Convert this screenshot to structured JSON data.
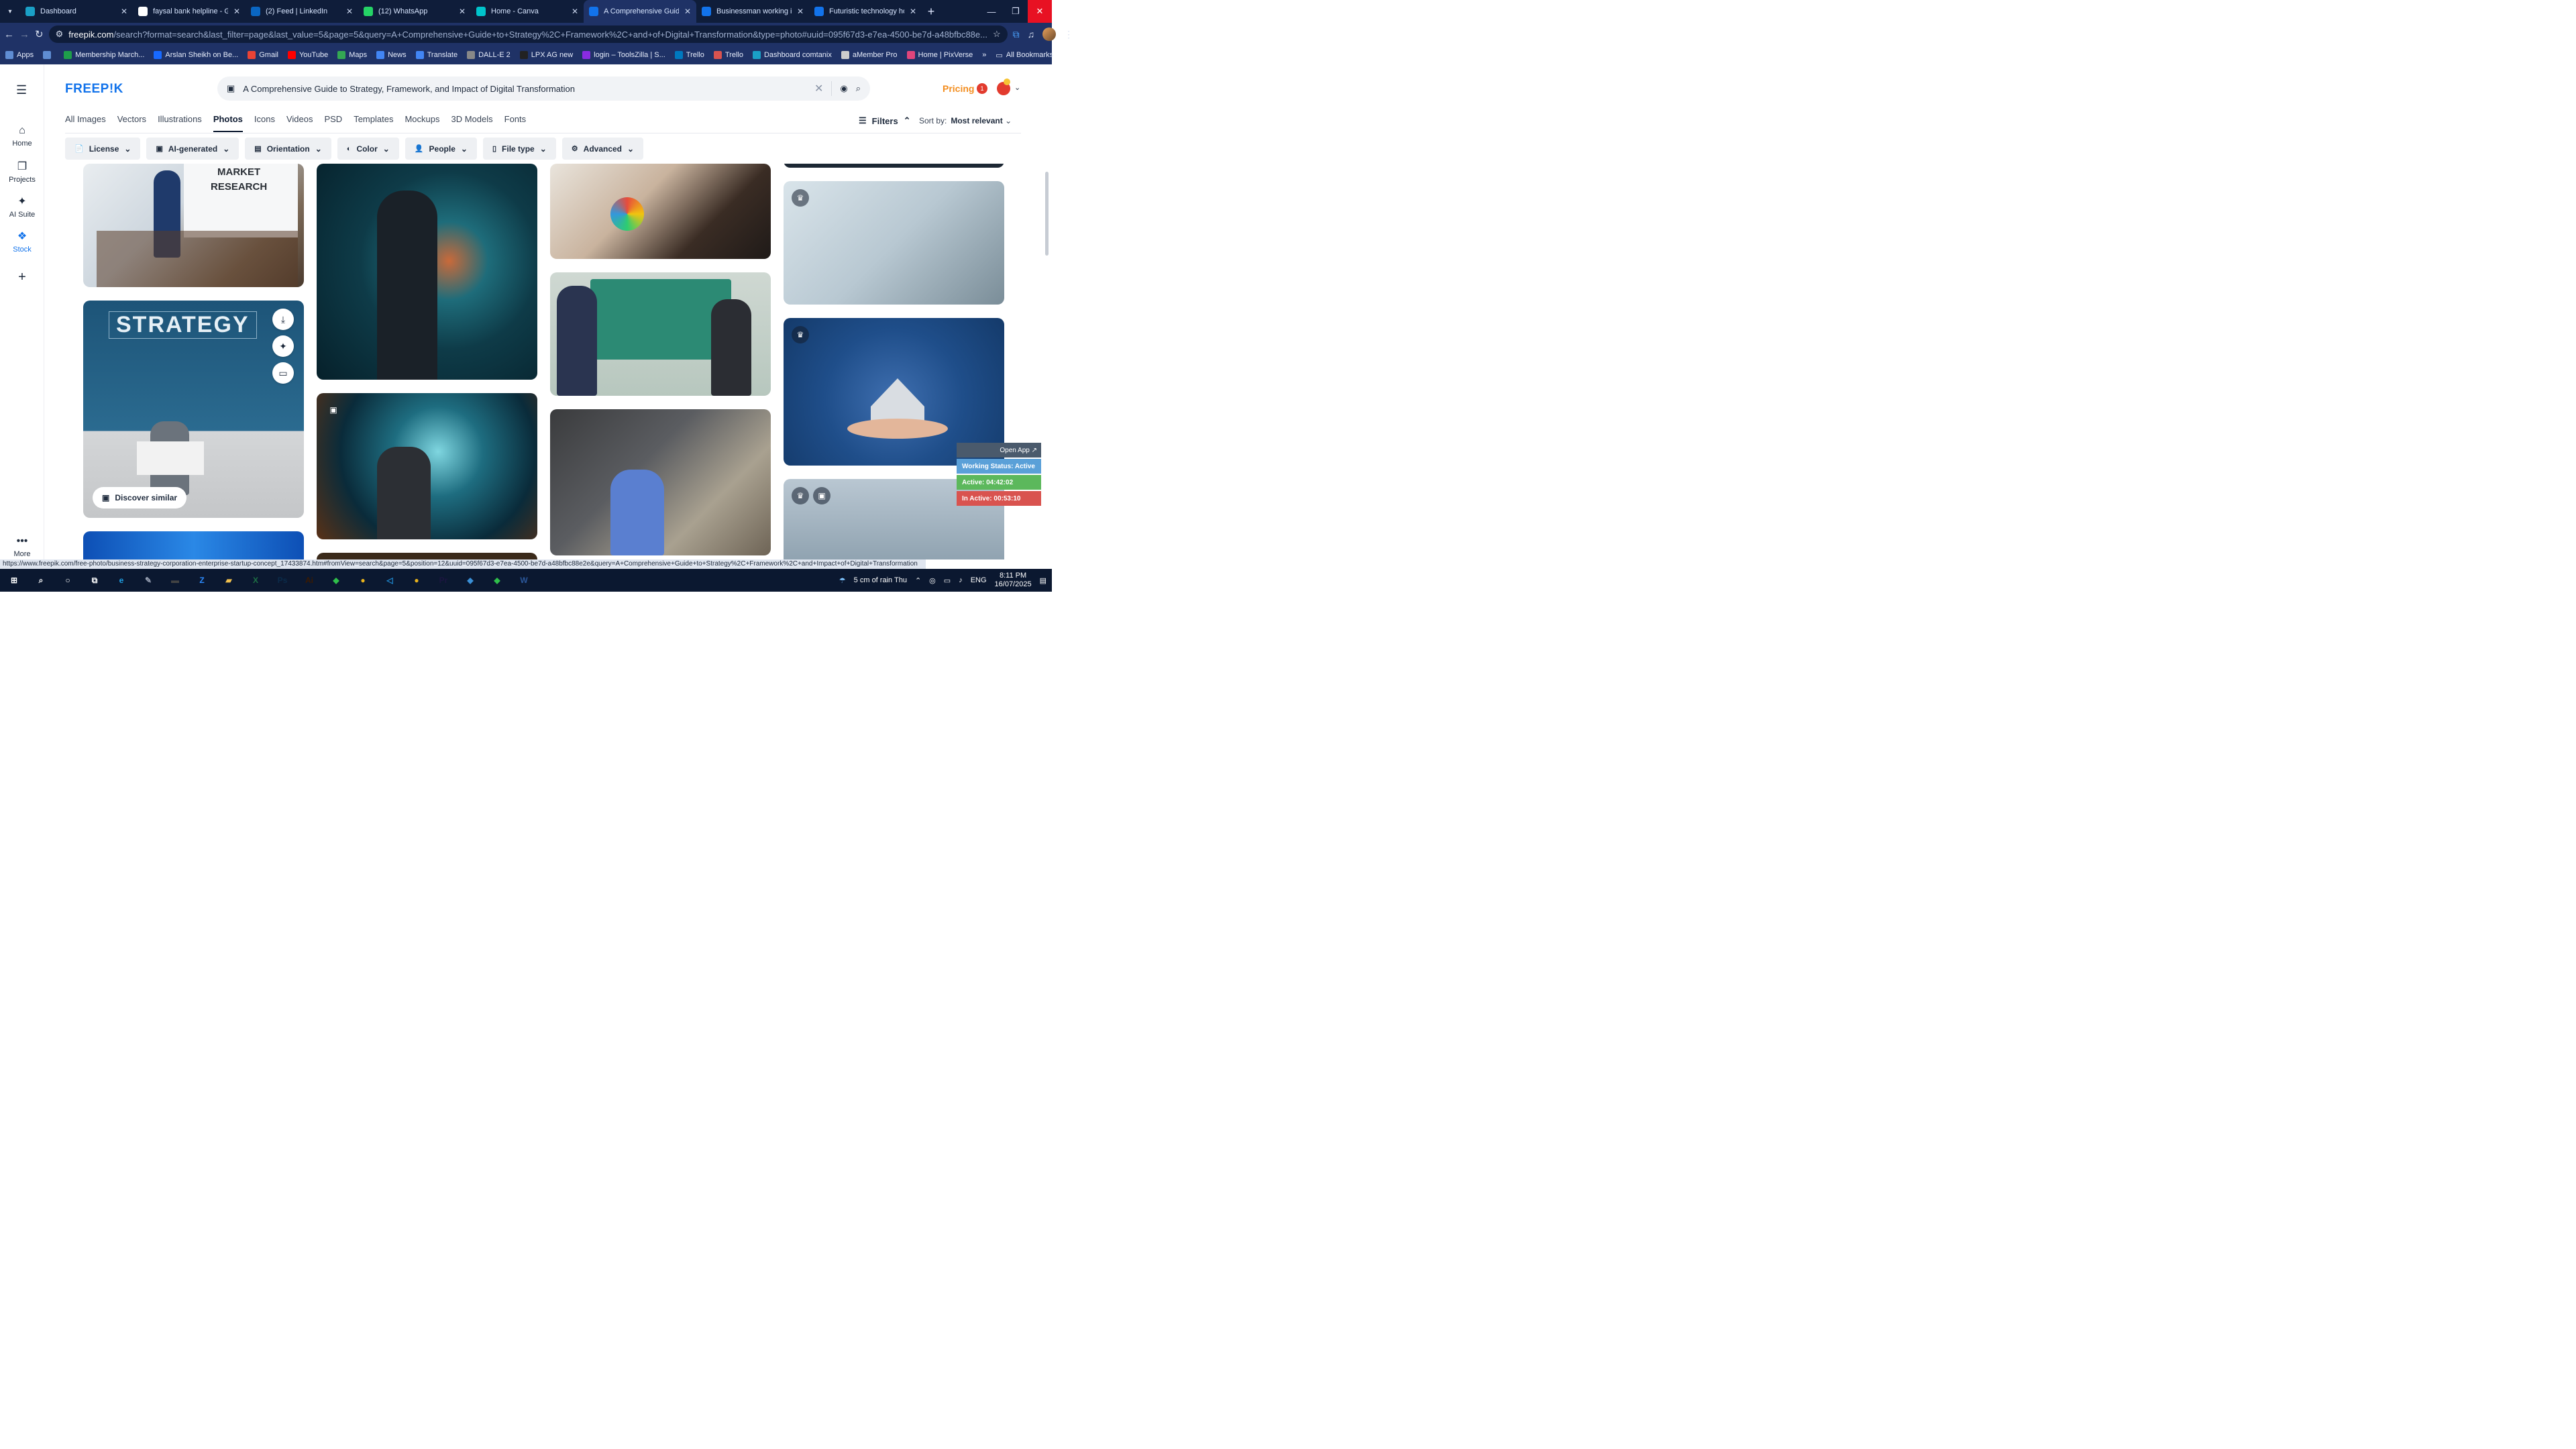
{
  "tabs": [
    {
      "title": "Dashboard",
      "color": "#1aa0c7"
    },
    {
      "title": "faysal bank helpline - Go",
      "color": "#ffffff"
    },
    {
      "title": "(2) Feed | LinkedIn",
      "color": "#0a66c2"
    },
    {
      "title": "(12) WhatsApp",
      "color": "#25d366"
    },
    {
      "title": "Home - Canva",
      "color": "#00c4cc"
    },
    {
      "title": "A Comprehensive Guide t",
      "color": "#1273eb"
    },
    {
      "title": "Businessman working in c",
      "color": "#1273eb"
    },
    {
      "title": "Futuristic technology holo",
      "color": "#1273eb"
    }
  ],
  "address": {
    "domain": "freepik.com",
    "path": "/search?format=search&last_filter=page&last_value=5&page=5&query=A+Comprehensive+Guide+to+Strategy%2C+Framework%2C+and+of+Digital+Transformation&type=photo#uuid=095f67d3-e7ea-4500-be7d-a48bfbc88e..."
  },
  "bookmarks": [
    {
      "label": "Apps",
      "color": "#5f8dd3"
    },
    {
      "label": "",
      "color": "#5f8dd3"
    },
    {
      "label": "Membership March...",
      "color": "#1e9e4a"
    },
    {
      "label": "Arslan Sheikh on Be...",
      "color": "#1769ff"
    },
    {
      "label": "Gmail",
      "color": "#ea4335"
    },
    {
      "label": "YouTube",
      "color": "#ff0000"
    },
    {
      "label": "Maps",
      "color": "#34a853"
    },
    {
      "label": "News",
      "color": "#4285f4"
    },
    {
      "label": "Translate",
      "color": "#4285f4"
    },
    {
      "label": "DALL-E 2",
      "color": "#888888"
    },
    {
      "label": "LPX AG new",
      "color": "#222222"
    },
    {
      "label": "login – ToolsZilla | S...",
      "color": "#8a2be2"
    },
    {
      "label": "Trello",
      "color": "#0079bf"
    },
    {
      "label": "Trello",
      "color": "#d9534f"
    },
    {
      "label": "Dashboard comtanix",
      "color": "#1aa0c7"
    },
    {
      "label": "aMember Pro",
      "color": "#cccccc"
    },
    {
      "label": "Home | PixVerse",
      "color": "#e0457b"
    }
  ],
  "all_bookmarks": "All Bookmarks",
  "rail": [
    {
      "label": "Home",
      "icon": "⌂"
    },
    {
      "label": "Projects",
      "icon": "❐"
    },
    {
      "label": "AI Suite",
      "icon": "✦"
    },
    {
      "label": "Stock",
      "icon": "❖"
    },
    {
      "label": "",
      "icon": "+"
    },
    {
      "label": "More",
      "icon": "•••"
    }
  ],
  "logo": "FREEP!K",
  "search_query": "A Comprehensive Guide to Strategy, Framework, and Impact of Digital Transformation",
  "pricing": "Pricing",
  "notif_count": "1",
  "categories": [
    "All Images",
    "Vectors",
    "Illustrations",
    "Photos",
    "Icons",
    "Videos",
    "PSD",
    "Templates",
    "Mockups",
    "3D Models",
    "Fonts"
  ],
  "active_category": "Photos",
  "filters_label": "Filters",
  "sort": {
    "label": "Sort by:",
    "value": "Most relevant"
  },
  "chips": [
    {
      "label": "License",
      "icon": "📄"
    },
    {
      "label": "AI-generated",
      "icon": "▣"
    },
    {
      "label": "Orientation",
      "icon": "▤"
    },
    {
      "label": "Color",
      "icon": "◐"
    },
    {
      "label": "People",
      "icon": "👤"
    },
    {
      "label": "File type",
      "icon": "▯"
    },
    {
      "label": "Advanced",
      "icon": "⚙"
    }
  ],
  "cards": {
    "market_research": "MARKET\nRESEARCH",
    "strategy": "STRATEGY",
    "discover": "Discover similar"
  },
  "overlay": {
    "open_app": "Open App ↗",
    "working": "Working Status: Active",
    "active": "Active: 04:42:02",
    "inactive": "In Active: 00:53:10"
  },
  "statusbar_url": "https://www.freepik.com/free-photo/business-strategy-corporation-enterprise-startup-concept_17433874.htm#fromView=search&page=5&position=12&uuid=095f67d3-e7ea-4500-be7d-a48bfbc88e2e&query=A+Comprehensive+Guide+to+Strategy%2C+Framework%2C+and+Impact+of+Digital+Transformation",
  "taskbar": {
    "weather": "5 cm of rain Thu",
    "lang": "ENG",
    "time": "8:11 PM",
    "date": "16/07/2025",
    "apps": [
      {
        "name": "start",
        "glyph": "⊞",
        "color": "#ffffff"
      },
      {
        "name": "search",
        "glyph": "⌕",
        "color": "#ffffff"
      },
      {
        "name": "cortana",
        "glyph": "○",
        "color": "#ffffff"
      },
      {
        "name": "taskview",
        "glyph": "⧉",
        "color": "#ffffff"
      },
      {
        "name": "edge",
        "glyph": "e",
        "color": "#1fa0e5"
      },
      {
        "name": "pen",
        "glyph": "✎",
        "color": "#9aa3b5"
      },
      {
        "name": "terminal",
        "glyph": "▬",
        "color": "#444444"
      },
      {
        "name": "zoom",
        "glyph": "Z",
        "color": "#2d8cff"
      },
      {
        "name": "files",
        "glyph": "▰",
        "color": "#f2c14e"
      },
      {
        "name": "excel",
        "glyph": "X",
        "color": "#1d7044"
      },
      {
        "name": "photoshop",
        "glyph": "Ps",
        "color": "#0b2b4a"
      },
      {
        "name": "illustrator",
        "glyph": "Ai",
        "color": "#3b1a00"
      },
      {
        "name": "bluestacks",
        "glyph": "◆",
        "color": "#2fbf4a"
      },
      {
        "name": "chrome",
        "glyph": "●",
        "color": "#e8b21c"
      },
      {
        "name": "vscode",
        "glyph": "◁",
        "color": "#1f8ad2"
      },
      {
        "name": "chrome-active",
        "glyph": "●",
        "color": "#e8b21c"
      },
      {
        "name": "premiere",
        "glyph": "Pr",
        "color": "#1b1540"
      },
      {
        "name": "app",
        "glyph": "◆",
        "color": "#3a8fd6"
      },
      {
        "name": "bluestacks2",
        "glyph": "◆",
        "color": "#2fbf4a"
      },
      {
        "name": "word",
        "glyph": "W",
        "color": "#2b579a"
      }
    ]
  }
}
